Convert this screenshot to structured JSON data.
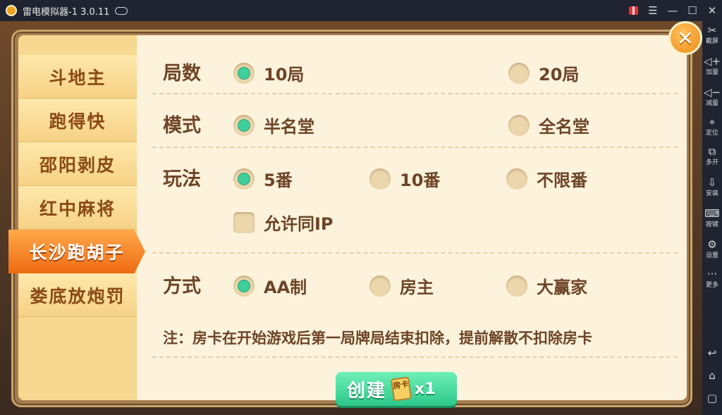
{
  "window": {
    "title": "雷电模拟器-1 3.0.11",
    "controls": [
      "gift-icon",
      "menu-icon",
      "minimize-icon",
      "maximize-icon",
      "close-icon"
    ]
  },
  "sidebar": {
    "items": [
      {
        "label": "截屏",
        "icon": "scissors-icon",
        "glyph": "✂"
      },
      {
        "label": "加量",
        "icon": "volume-up-icon",
        "glyph": "◁+"
      },
      {
        "label": "减量",
        "icon": "volume-down-icon",
        "glyph": "◁−"
      },
      {
        "label": "定位",
        "icon": "location-pin-icon",
        "glyph": "⌖"
      },
      {
        "label": "多开",
        "icon": "multi-window-icon",
        "glyph": "⧉"
      },
      {
        "label": "安装",
        "icon": "apk-install-icon",
        "glyph": "⇩"
      },
      {
        "label": "按键",
        "icon": "keyboard-icon",
        "glyph": "⌨"
      },
      {
        "label": "设置",
        "icon": "settings-gear-icon",
        "glyph": "⚙"
      },
      {
        "label": "更多",
        "icon": "more-dots-icon",
        "glyph": "···"
      }
    ],
    "nav": [
      {
        "icon": "back-icon",
        "glyph": "↩"
      },
      {
        "icon": "home-icon",
        "glyph": "⌂"
      },
      {
        "icon": "recent-apps-icon",
        "glyph": "▢"
      }
    ]
  },
  "game_menu": {
    "items": [
      "斗地主",
      "跑得快",
      "邵阳剥皮",
      "红中麻将",
      "长沙跑胡子",
      "娄底放炮罚"
    ],
    "active_index": 4
  },
  "settings": {
    "rounds": {
      "label": "局数",
      "options": [
        "10局",
        "20局"
      ],
      "selected": "10局"
    },
    "mode": {
      "label": "模式",
      "options": [
        "半名堂",
        "全名堂"
      ],
      "selected": "半名堂"
    },
    "play": {
      "label": "玩法",
      "options": [
        "5番",
        "10番",
        "不限番"
      ],
      "selected": "5番",
      "checkbox": "允许同IP",
      "checkbox_checked": false
    },
    "payment": {
      "label": "方式",
      "options": [
        "AA制",
        "房主",
        "大赢家"
      ],
      "selected": "AA制"
    }
  },
  "note": "注：房卡在开始游戏后第一局牌局结束扣除，提前解散不扣除房卡",
  "create": {
    "label": "创建",
    "card_text": "房卡",
    "count": "x1"
  },
  "colors": {
    "accent_green": "#3fcf9a",
    "active_tab": "#ef6b12",
    "text_brown": "#6d4426"
  }
}
